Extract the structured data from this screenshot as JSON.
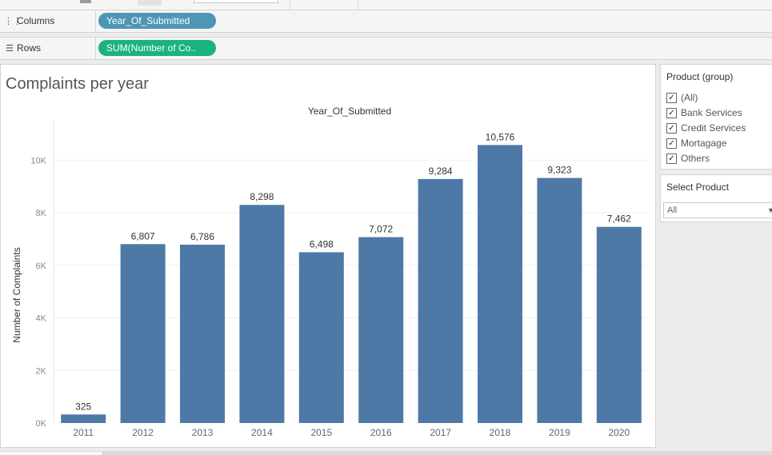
{
  "shelves": {
    "columns": {
      "label": "Columns",
      "pill": "Year_Of_Submitted"
    },
    "rows": {
      "label": "Rows",
      "pill": "SUM(Number of Co.."
    }
  },
  "sheet": {
    "title": "Complaints per year"
  },
  "colors": {
    "bar": "#4e79a7",
    "dimension_pill": "#4d97b5",
    "measure_pill": "#1ab37d"
  },
  "chart_data": {
    "type": "bar",
    "title": "Year_Of_Submitted",
    "xlabel": "",
    "ylabel": "Number of Complaints",
    "categories": [
      "2011",
      "2012",
      "2013",
      "2014",
      "2015",
      "2016",
      "2017",
      "2018",
      "2019",
      "2020"
    ],
    "values": [
      325,
      6807,
      6786,
      8298,
      6498,
      7072,
      9284,
      10576,
      9323,
      7462
    ],
    "data_labels": [
      "325",
      "6,807",
      "6,786",
      "8,298",
      "6,498",
      "7,072",
      "9,284",
      "10,576",
      "9,323",
      "7,462"
    ],
    "ylim": [
      0,
      11500
    ],
    "yticks": [
      0,
      2000,
      4000,
      6000,
      8000,
      10000
    ],
    "ytick_labels": [
      "0K",
      "2K",
      "4K",
      "6K",
      "8K",
      "10K"
    ],
    "grid": true
  },
  "filters": {
    "product_group": {
      "title": "Product (group)",
      "items": [
        {
          "label": "(All)",
          "checked": true
        },
        {
          "label": "Bank Services",
          "checked": true
        },
        {
          "label": "Credit Services",
          "checked": true
        },
        {
          "label": "Mortagage",
          "checked": true
        },
        {
          "label": "Others",
          "checked": true
        }
      ]
    },
    "select_product": {
      "title": "Select Product",
      "value": "All"
    }
  }
}
